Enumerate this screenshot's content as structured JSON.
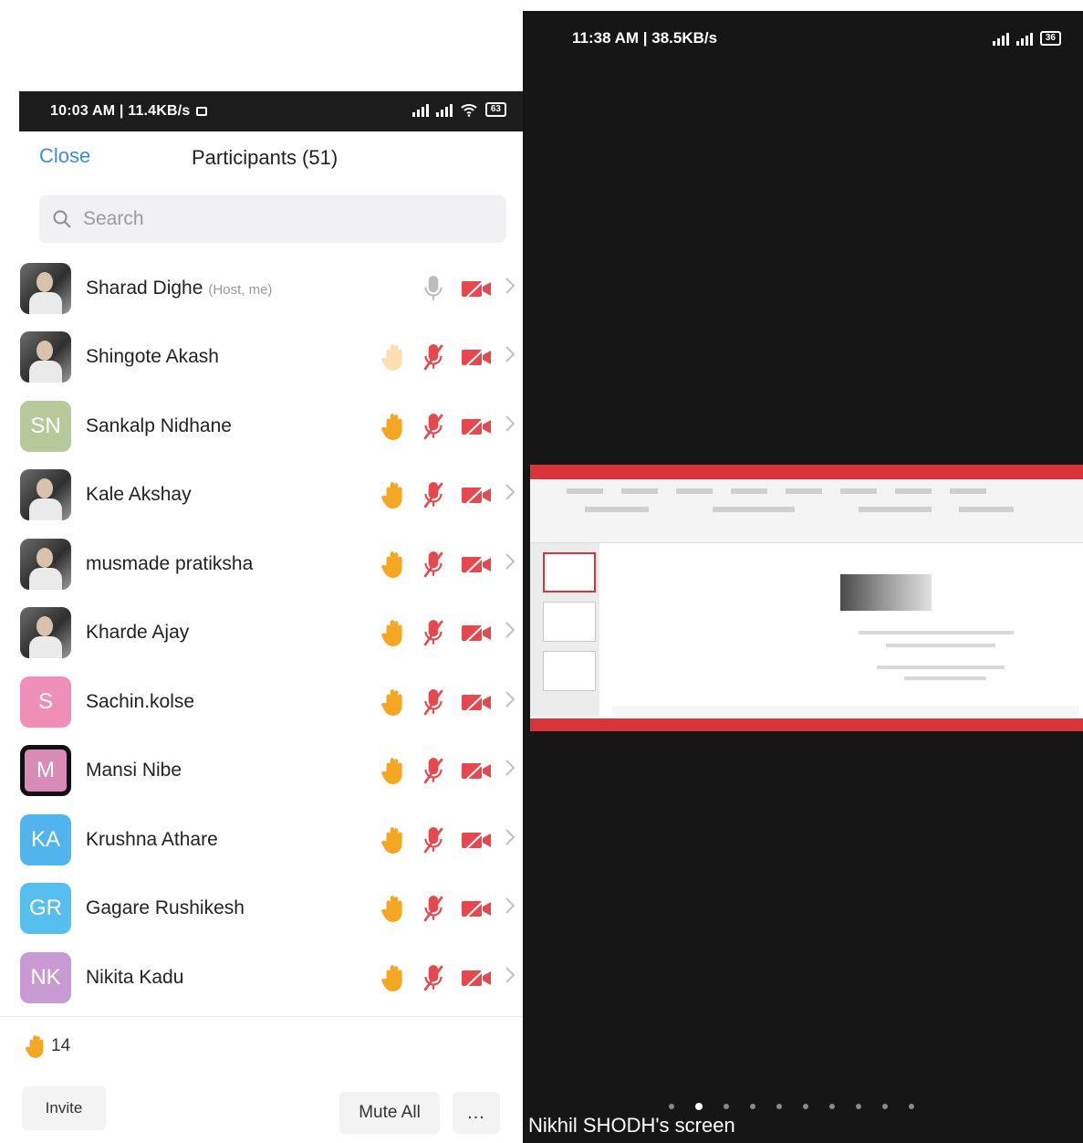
{
  "left_status": {
    "text": "10:03 AM | 11.4KB/s",
    "battery": "63"
  },
  "header": {
    "close_label": "Close",
    "title": "Participants (51)"
  },
  "search": {
    "placeholder": "Search"
  },
  "participants": [
    {
      "name": "Sharad Dighe",
      "tag": "(Host, me)",
      "avatar_type": "photo",
      "initials": "",
      "avatar_color": "",
      "hand_raised": false,
      "mic_muted": false,
      "video_off": true
    },
    {
      "name": "Shingote Akash",
      "tag": "",
      "avatar_type": "photo",
      "initials": "",
      "avatar_color": "",
      "hand_raised": true,
      "hand_faded": true,
      "mic_muted": true,
      "video_off": true
    },
    {
      "name": "Sankalp Nidhane",
      "tag": "",
      "avatar_type": "initials",
      "initials": "SN",
      "avatar_color": "#b7c89a",
      "hand_raised": true,
      "mic_muted": true,
      "video_off": true
    },
    {
      "name": "Kale Akshay",
      "tag": "",
      "avatar_type": "photo",
      "initials": "",
      "avatar_color": "",
      "hand_raised": true,
      "mic_muted": true,
      "video_off": true
    },
    {
      "name": "musmade pratiksha",
      "tag": "",
      "avatar_type": "photo",
      "initials": "",
      "avatar_color": "",
      "hand_raised": true,
      "mic_muted": true,
      "video_off": true
    },
    {
      "name": "Kharde Ajay",
      "tag": "",
      "avatar_type": "photo",
      "initials": "",
      "avatar_color": "",
      "hand_raised": true,
      "mic_muted": true,
      "video_off": true
    },
    {
      "name": "Sachin.kolse",
      "tag": "",
      "avatar_type": "initials",
      "initials": "S",
      "avatar_color": "#ef8fb7",
      "hand_raised": true,
      "mic_muted": true,
      "video_off": true
    },
    {
      "name": "Mansi Nibe",
      "tag": "",
      "avatar_type": "initials",
      "initials": "M",
      "avatar_color": "#d98bb8",
      "ring": true,
      "hand_raised": true,
      "mic_muted": true,
      "video_off": true
    },
    {
      "name": "Krushna Athare",
      "tag": "",
      "avatar_type": "initials",
      "initials": "KA",
      "avatar_color": "#52b4ec",
      "hand_raised": true,
      "mic_muted": true,
      "video_off": true
    },
    {
      "name": "Gagare Rushikesh",
      "tag": "",
      "avatar_type": "initials",
      "initials": "GR",
      "avatar_color": "#56bff0",
      "hand_raised": true,
      "mic_muted": true,
      "video_off": true
    },
    {
      "name": "Nikita Kadu",
      "tag": "",
      "avatar_type": "initials",
      "initials": "NK",
      "avatar_color": "#c79ad2",
      "hand_raised": true,
      "mic_muted": true,
      "video_off": true
    }
  ],
  "footer": {
    "hand_count": "14",
    "invite_label": "Invite",
    "mute_all_label": "Mute All",
    "more_label": "..."
  },
  "right_status": {
    "text": "11:38 AM | 38.5KB/s",
    "battery": "36"
  },
  "share": {
    "screen_label": "Nikhil SHODH's screen",
    "page_dots": 10,
    "active_dot": 1
  },
  "colors": {
    "accent_blue": "#3b8ed8",
    "hand_orange": "#f5a623",
    "mute_red": "#e5484d",
    "ppt_red": "#d9343a"
  },
  "icons": {
    "search": "search-icon",
    "hand": "raised-hand-icon",
    "mic": "microphone-icon",
    "video": "video-off-icon",
    "chevron": "chevron-right-icon"
  }
}
